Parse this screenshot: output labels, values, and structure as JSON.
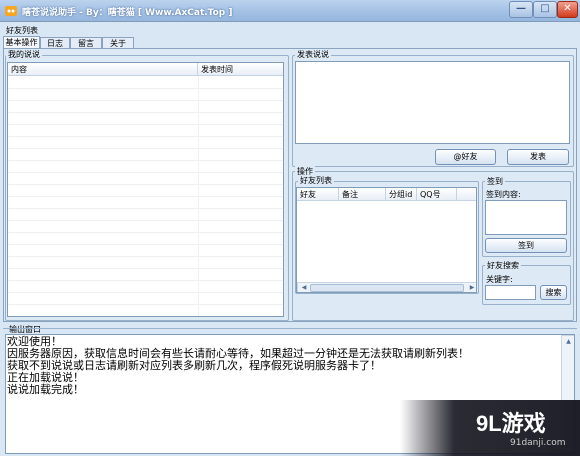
{
  "window": {
    "title": "瞎苍说说助手 - By：瞎苍猫 [ Www.AxCat.Top ]",
    "min_glyph": "—",
    "max_glyph": "□",
    "close_glyph": "✕"
  },
  "menu": {
    "friend_list": "好友列表"
  },
  "tabs": [
    "基本操作",
    "日志",
    "留言",
    "关于"
  ],
  "my_shuoshuo": {
    "group_title": "我的说说",
    "columns": [
      "内容",
      "发表时间"
    ]
  },
  "publish": {
    "group_title": "发表说说",
    "at_friend_label": "@好友",
    "publish_label": "发表"
  },
  "operations": {
    "group_title": "操作",
    "friend_list_title": "好友列表",
    "columns": [
      "好友",
      "备注",
      "分组id",
      "QQ号"
    ]
  },
  "checkin": {
    "group_title": "签到",
    "content_label": "签到内容:",
    "button_label": "签到"
  },
  "friend_search": {
    "group_title": "好友搜索",
    "keyword_label": "关键字:",
    "search_label": "搜索"
  },
  "output": {
    "group_title": "输出窗口",
    "lines": [
      "欢迎使用！",
      "因服务器原因，获取信息时间会有些长请耐心等待，如果超过一分钟还是无法获取请刷新列表！",
      "获取不到说说或日志请刷新对应列表多刷新几次，程序假死说明服务器卡了！",
      "正在加载说说！",
      "说说加载完成！"
    ]
  },
  "watermark": {
    "brand": "9L游戏",
    "url": "91danji.com"
  },
  "colors": {
    "title_bar": "#a7c3e6",
    "panel": "#dde9f5",
    "close_button": "#d23a1e"
  }
}
